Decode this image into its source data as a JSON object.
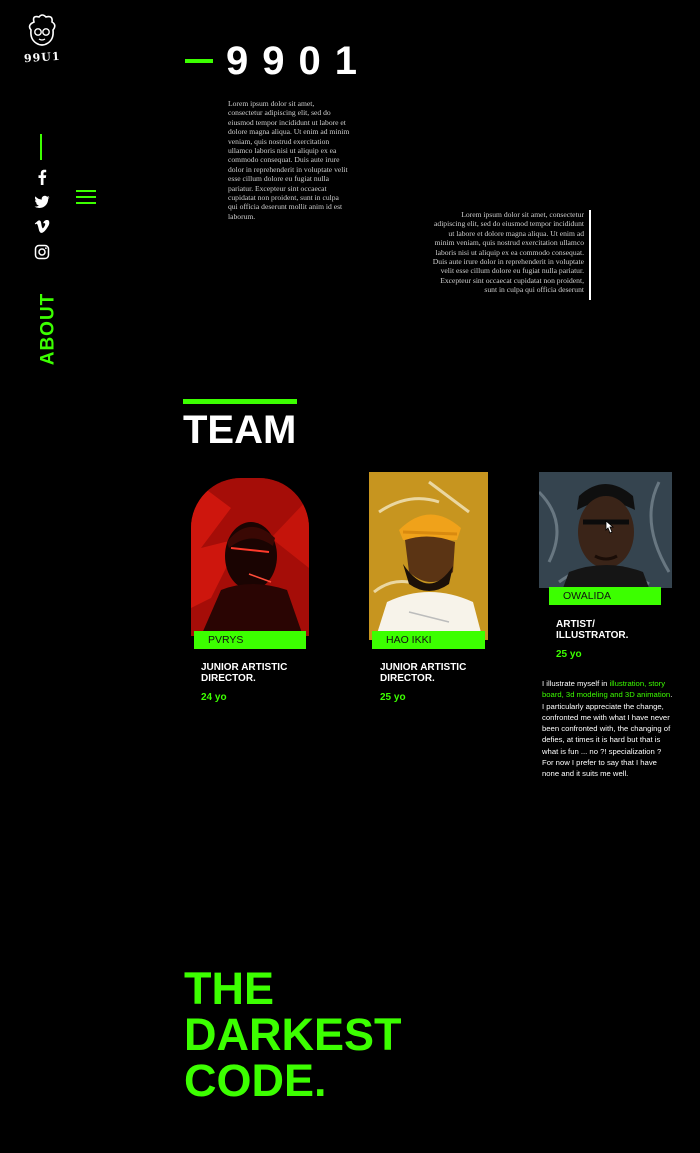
{
  "brand": {
    "logo_text": "99U1"
  },
  "sidebar": {
    "social": [
      "facebook-icon",
      "twitter-icon",
      "vimeo-icon",
      "instagram-icon"
    ],
    "section_label": "ABOUT"
  },
  "hero": {
    "title": "9901",
    "paragraph_1": "Lorem ipsum dolor sit amet, consectetur adipiscing elit, sed do eiusmod tempor incididunt ut labore et dolore magna aliqua. Ut enim ad minim veniam, quis nostrud exercitation ullamco laboris nisi ut aliquip ex ea commodo consequat. Duis aute irure dolor in reprehenderit in voluptate velit esse cillum dolore eu fugiat nulla pariatur. Excepteur sint occaecat cupidatat non proident, sunt in culpa qui officia deserunt mollit anim id est laborum.",
    "paragraph_2": "Lorem ipsum dolor sit amet, consectetur adipiscing elit, sed do eiusmod tempor incididunt ut labore et dolore magna aliqua. Ut enim ad minim veniam, quis nostrud exercitation ullamco laboris nisi ut aliquip ex ea commodo consequat. Duis aute irure dolor in reprehenderit in voluptate velit esse cillum dolore eu fugiat nulla pariatur. Excepteur sint occaecat cupidatat non proident, sunt in culpa qui officia deserunt"
  },
  "team": {
    "title": "TEAM",
    "members": [
      {
        "name": "PVRYS",
        "role": "JUNIOR ARTISTIC DIRECTOR.",
        "age": "24 yo"
      },
      {
        "name": "HAO IKKI",
        "role": "JUNIOR ARTISTIC DIRECTOR.",
        "age": "25 yo"
      },
      {
        "name": "OWALIDA",
        "role": "ARTIST/ ILLUSTRATOR.",
        "age": "25 yo",
        "bio_intro": "I illustrate myself in ",
        "bio_highlight": "illustration, story board, 3d modeling and 3D animation",
        "bio_rest": ". I particularly appreciate the change, confronted me with what I have never been confronted with, the changing of defies, at times it is hard but that is what is fun ... no ?! specialization ? For now I prefer to say that I have none and it suits me well."
      }
    ]
  },
  "footer": {
    "line_1": "THE",
    "line_2": "DARKEST",
    "line_3": "CODE."
  },
  "colors": {
    "accent": "#3cff00",
    "background": "#000000",
    "text": "#ffffff"
  }
}
